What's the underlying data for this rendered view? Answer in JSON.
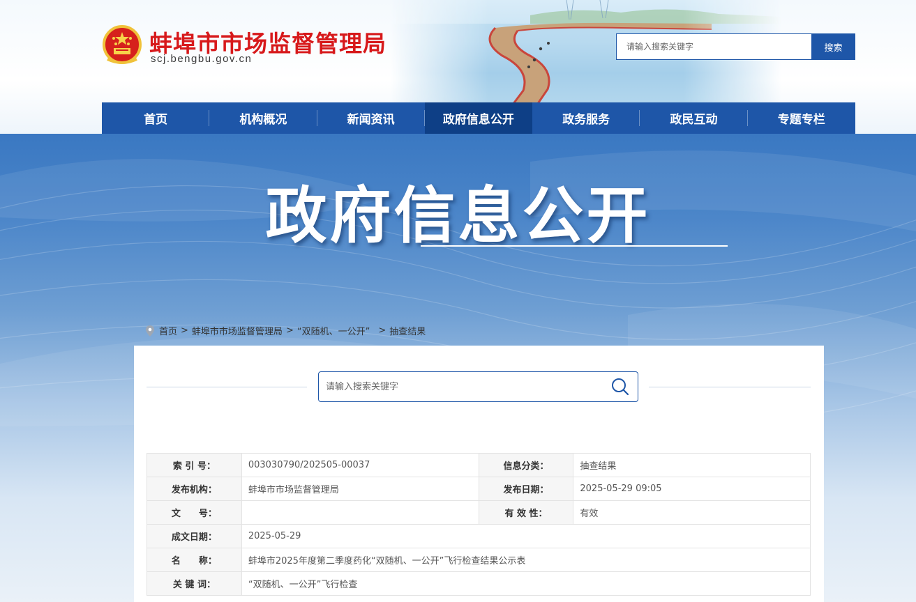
{
  "site": {
    "title": "蚌埠市市场监督管理局",
    "url": "scj.bengbu.gov.cn"
  },
  "top_search": {
    "placeholder": "请输入搜索关键字",
    "button_label": "搜索"
  },
  "nav": {
    "items": [
      {
        "label": "首页"
      },
      {
        "label": "机构概况"
      },
      {
        "label": "新闻资讯"
      },
      {
        "label": "政府信息公开",
        "active": true
      },
      {
        "label": "政务服务"
      },
      {
        "label": "政民互动"
      },
      {
        "label": "专题专栏"
      }
    ]
  },
  "banner": {
    "title": "政府信息公开"
  },
  "breadcrumb": {
    "items": [
      "首页",
      "蚌埠市市场监督管理局",
      "“双随机、一公开”",
      "抽查结果"
    ],
    "separator": ">"
  },
  "content_search": {
    "placeholder": "请输入搜索关键字"
  },
  "meta_table": {
    "index_no_label": "索 引 号：",
    "index_no": "003030790/202505-00037",
    "category_label": "信息分类：",
    "category": "抽查结果",
    "publisher_label": "发布机构：",
    "publisher": "蚌埠市市场监督管理局",
    "publish_date_label": "发布日期：",
    "publish_date": "2025-05-29 09:05",
    "doc_no_label": "文　　号：",
    "doc_no": "",
    "validity_label": "有 效 性：",
    "validity": "有效",
    "created_date_label": "成文日期：",
    "created_date": "2025-05-29",
    "name_label": "名　　称：",
    "name": "蚌埠市2025年度第二季度药化“双随机、一公开”飞行检查结果公示表",
    "keywords_label": "关 键 词：",
    "keywords": "“双随机、一公开”飞行检查"
  },
  "colors": {
    "brand_blue": "#1e56a8",
    "nav_active": "#0e3f86",
    "title_red": "#d7191b"
  }
}
